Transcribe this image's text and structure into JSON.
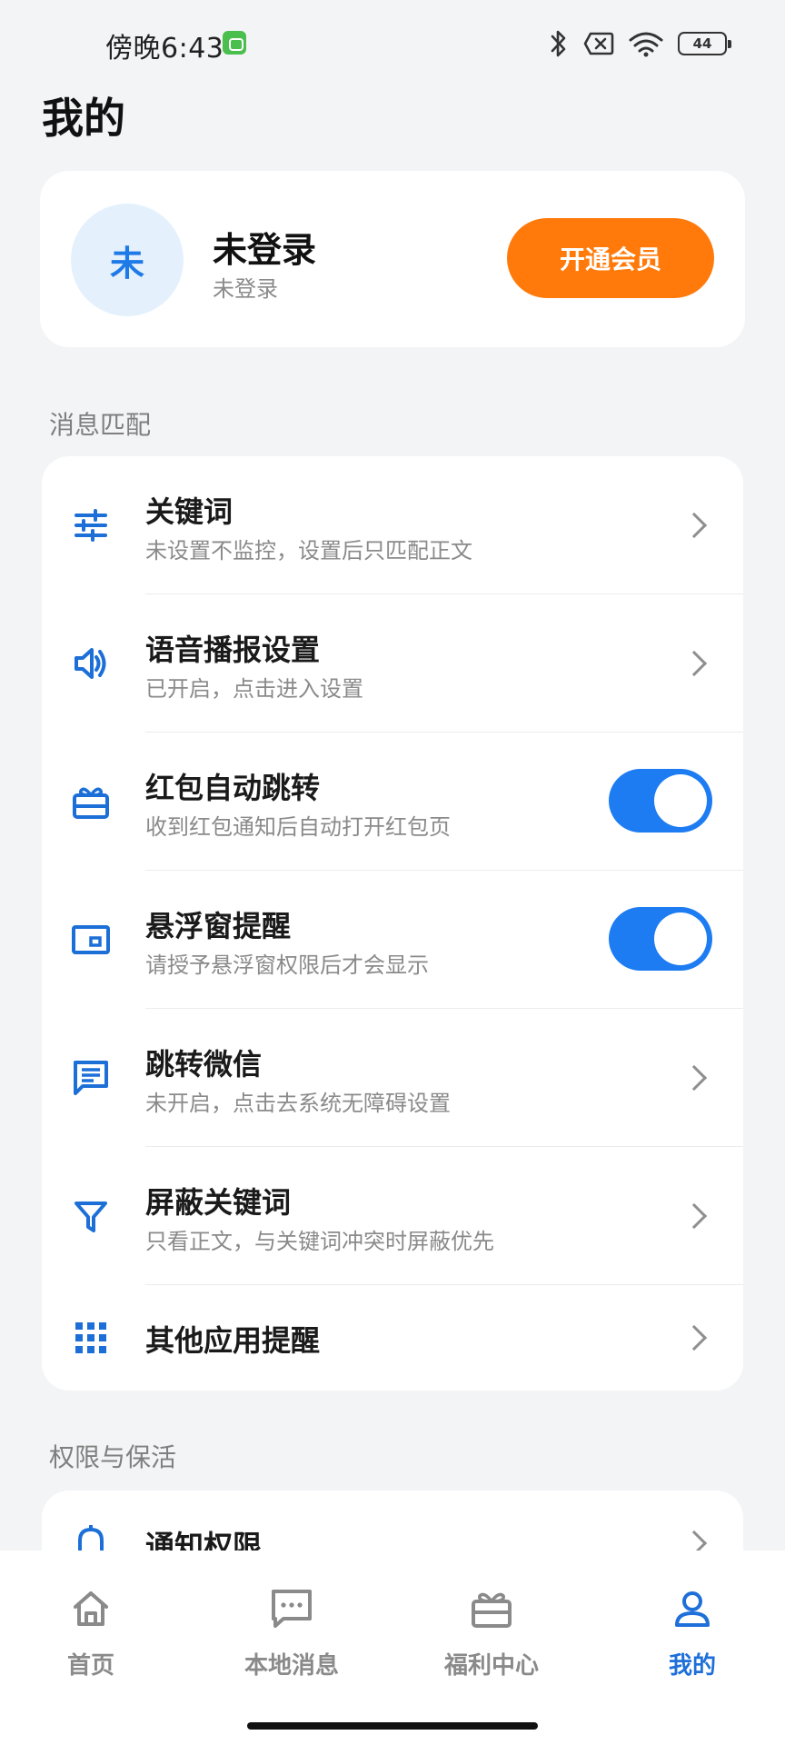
{
  "status_bar": {
    "time": "傍晚6:43",
    "battery": "44"
  },
  "page": {
    "title": "我的"
  },
  "profile": {
    "avatar_text": "未",
    "name": "未登录",
    "subtitle": "未登录",
    "vip_button": "开通会员"
  },
  "sections": {
    "message_match": "消息匹配",
    "permissions": "权限与保活"
  },
  "message_items": [
    {
      "title": "关键词",
      "subtitle": "未设置不监控，设置后只匹配正文",
      "icon": "sliders-icon",
      "control": "chevron"
    },
    {
      "title": "语音播报设置",
      "subtitle": "已开启，点击进入设置",
      "icon": "speaker-icon",
      "control": "chevron"
    },
    {
      "title": "红包自动跳转",
      "subtitle": "收到红包通知后自动打开红包页",
      "icon": "gift-card-icon",
      "control": "toggle",
      "toggle_on": true
    },
    {
      "title": "悬浮窗提醒",
      "subtitle": "请授予悬浮窗权限后才会显示",
      "icon": "floating-window-icon",
      "control": "toggle",
      "toggle_on": true
    },
    {
      "title": "跳转微信",
      "subtitle": "未开启，点击去系统无障碍设置",
      "icon": "chat-icon",
      "control": "chevron"
    },
    {
      "title": "屏蔽关键词",
      "subtitle": "只看正文，与关键词冲突时屏蔽优先",
      "icon": "filter-icon",
      "control": "chevron"
    },
    {
      "title": "其他应用提醒",
      "subtitle": "",
      "icon": "apps-grid-icon",
      "control": "chevron"
    }
  ],
  "permission_items": [
    {
      "title": "通知权限",
      "icon": "bell-icon",
      "control": "chevron"
    }
  ],
  "bottom_nav": [
    {
      "label": "首页",
      "icon": "home-icon",
      "active": false
    },
    {
      "label": "本地消息",
      "icon": "message-icon",
      "active": false
    },
    {
      "label": "福利中心",
      "icon": "gift-icon",
      "active": false
    },
    {
      "label": "我的",
      "icon": "user-icon",
      "active": true
    }
  ],
  "colors": {
    "accent": "#1d7cf2",
    "vip": "#ff7a0a",
    "background": "#f3f4f6"
  }
}
